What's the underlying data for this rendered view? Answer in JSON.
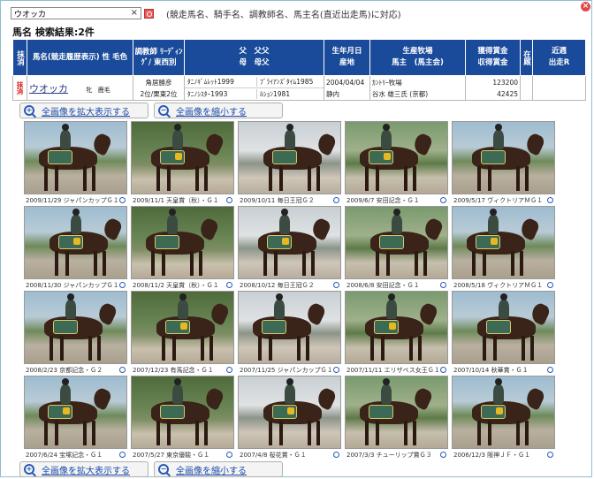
{
  "search": {
    "value": "ウオッカ",
    "placeholder": ""
  },
  "hint": "(競走馬名、騎手名、調教師名、馬主名(直近出走馬)に対応)",
  "result_title": "馬名 検索結果:2件",
  "table": {
    "headers": {
      "delete": "抹消",
      "name": "馬名(競走履歴表示) 性 毛色",
      "trainer": "調教師 ﾘｰﾃﾞｨﾝｸﾞ/ 東西別",
      "pedigree_1": "父　父父",
      "pedigree_2": "母　母父",
      "birth_1": "生年月日",
      "birth_2": "産地",
      "farm_1": "生産牧場",
      "farm_2": "馬主　(馬主会)",
      "prize_1": "獲得賞金",
      "prize_2": "収得賞金",
      "stable": "在厩",
      "recent_1": "近週",
      "recent_2": "出走R"
    },
    "row": {
      "delete": "抹消",
      "name": "ウオッカ",
      "sex": "牝",
      "color": "鹿毛",
      "trainer_1": "角居勝彦",
      "trainer_2": "2位/栗東2位",
      "sire": "ﾀﾆﾉｷﾞﾑﾚｯﾄ1999",
      "sire_sire": "ﾌﾞﾗｲｱﾝｽﾞﾀｲﾑ1985",
      "dam": "ﾀﾆﾉｼｽﾀｰ1993",
      "dam_sire": "ﾙｼｮﾝ1981",
      "birth": "2004/04/04",
      "region": "静内",
      "farm": "ｶﾝﾄﾘｰ牧場",
      "owner": "谷水 雄三氏 (京都)",
      "prize_earned": "123200",
      "prize_income": "42425",
      "stable": "",
      "recent": ""
    }
  },
  "zoom": {
    "expand": "全画像を拡大表示する",
    "shrink": "全画像を縮小する"
  },
  "photos": [
    "2009/11/29 ジャパンカップＧ１",
    "2009/11/1 天皇賞（秋）・Ｇ１",
    "2009/10/11 毎日王冠Ｇ２",
    "2009/6/7 安田記念・Ｇ１",
    "2009/5/17 ヴィクトリアＭＧ１",
    "2008/11/30 ジャパンカップＧ１",
    "2008/11/2 天皇賞（秋）・Ｇ１",
    "2008/10/12 毎日王冠Ｇ２",
    "2008/6/8 安田記念・Ｇ１",
    "2008/5/18 ヴィクトリアＭＧ１",
    "2008/2/23 京都記念・Ｇ２",
    "2007/12/23 有馬記念・Ｇ１",
    "2007/11/25 ジャパンカップＧ１",
    "2007/11/11 エリザベス女王Ｇ１",
    "2007/10/14 秋華賞・Ｇ１",
    "2007/6/24 宝塚記念・Ｇ１",
    "2007/5/27 東京優駿・Ｇ１",
    "2007/4/8 桜花賞・Ｇ１",
    "2007/3/3 チューリップ賞Ｇ３",
    "2006/12/3 阪神ＪＦ・Ｇ１"
  ],
  "icons": {
    "clear": "close-icon",
    "search": "search-icon",
    "zoom_in": "zoom-in-icon",
    "zoom_out": "zoom-out-icon"
  },
  "colors": {
    "header_bg": "#1a4a9a",
    "delete_red": "#d62020",
    "link_blue": "#1c4aa8"
  }
}
